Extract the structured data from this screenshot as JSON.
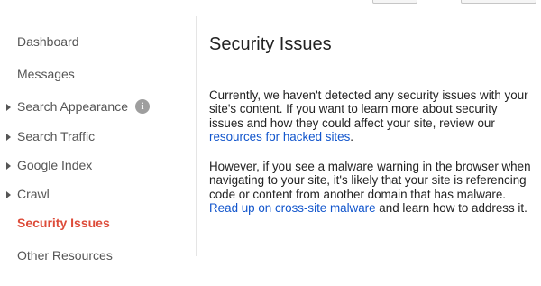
{
  "sidebar": {
    "items": [
      {
        "label": "Dashboard",
        "expandable": false,
        "active": false
      },
      {
        "label": "Messages",
        "expandable": false,
        "active": false
      },
      {
        "label": "Search Appearance",
        "expandable": true,
        "active": false,
        "info_icon": "info-icon"
      },
      {
        "label": "Search Traffic",
        "expandable": true,
        "active": false
      },
      {
        "label": "Google Index",
        "expandable": true,
        "active": false
      },
      {
        "label": "Crawl",
        "expandable": true,
        "active": false
      },
      {
        "label": "Security Issues",
        "expandable": false,
        "active": true
      },
      {
        "label": "Other Resources",
        "expandable": false,
        "active": false
      }
    ],
    "info_glyph": "i"
  },
  "main": {
    "title": "Security Issues",
    "paragraph1": {
      "text_before": "Currently, we haven't detected any security issues with your site's content. If you want to learn more about security issues and how they could affect your site, review our ",
      "link": "resources for hacked sites",
      "text_after": "."
    },
    "paragraph2": {
      "text_before": "However, if you see a malware warning in the browser when navigating to your site, it's likely that your site is referencing code or content from another domain that has malware. ",
      "link": "Read up on cross-site malware",
      "text_after": " and learn how to address it."
    }
  },
  "colors": {
    "active_nav": "#dd4b39",
    "link": "#1155cc",
    "nav_text": "#555555",
    "body_text": "#222222"
  }
}
